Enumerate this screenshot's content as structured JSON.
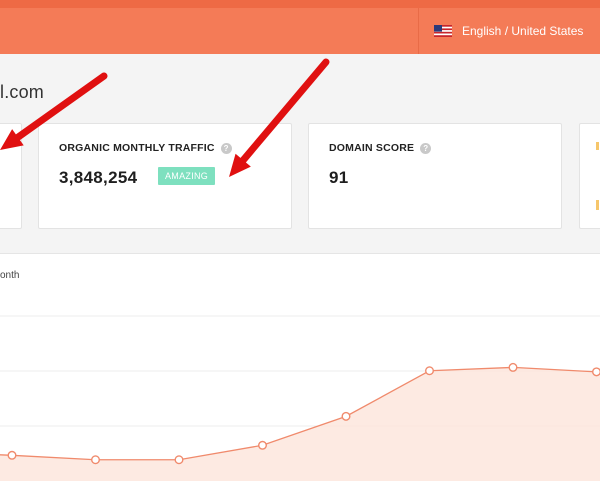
{
  "header": {
    "language_label": "English / United States"
  },
  "domain": {
    "title_fragment": "l.com"
  },
  "cards": {
    "traffic": {
      "label": "ORGANIC MONTHLY TRAFFIC",
      "value": "3,848,254",
      "badge": "AMAZING"
    },
    "domain_score": {
      "label": "DOMAIN SCORE",
      "value": "91"
    }
  },
  "chart": {
    "caption": "onth"
  },
  "chart_data": {
    "type": "area",
    "title": "",
    "xlabel": "",
    "ylabel": "",
    "series": [
      {
        "values": [
          0.24,
          0.2,
          0.2,
          0.33,
          0.59,
          1.0,
          1.03,
          0.99
        ]
      }
    ],
    "ylim": [
      0,
      1.6
    ],
    "grid": true,
    "colors": {
      "line": "#f08a6c",
      "fill": "#fde6dd"
    }
  },
  "colors": {
    "accent": "#f47b57",
    "badge": "#7ee0bf",
    "annotation_arrow": "#e01010"
  },
  "icons": {
    "flag": "us-flag-icon",
    "help": "question-circle-icon"
  },
  "help_glyph": "?"
}
